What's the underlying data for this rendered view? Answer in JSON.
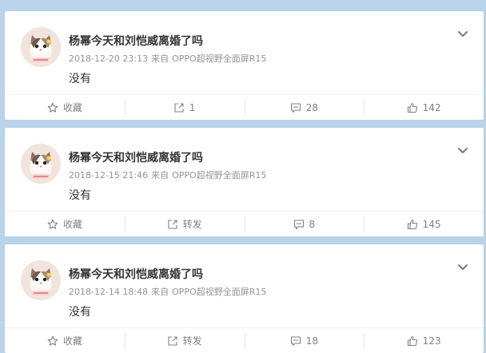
{
  "colors": {
    "page_background": "#b8d3ea",
    "card_background": "#ffffff",
    "text_primary": "#333333",
    "text_secondary": "#939393",
    "action_text": "#808080"
  },
  "icons": {
    "favorite": "star-icon",
    "repost": "share-icon",
    "comment": "comment-icon",
    "like": "thumb-up-icon",
    "menu": "chevron-down-icon"
  },
  "posts": [
    {
      "user": "杨幂今天和刘恺威离婚了吗",
      "time": "2018-12-20 23:13",
      "source_prefix": "来自",
      "source": "OPPO超视野全面屏R15",
      "text": "没有",
      "favorite_label": "收藏",
      "repost_label": "1",
      "comment_label": "28",
      "like_label": "142"
    },
    {
      "user": "杨幂今天和刘恺威离婚了吗",
      "time": "2018-12-15 21:46",
      "source_prefix": "来自",
      "source": "OPPO超视野全面屏R15",
      "text": "没有",
      "favorite_label": "收藏",
      "repost_label": "转发",
      "comment_label": "8",
      "like_label": "145"
    },
    {
      "user": "杨幂今天和刘恺威离婚了吗",
      "time": "2018-12-14 18:48",
      "source_prefix": "来自",
      "source": "OPPO超视野全面屏R15",
      "text": "没有",
      "favorite_label": "收藏",
      "repost_label": "转发",
      "comment_label": "18",
      "like_label": "123"
    }
  ]
}
